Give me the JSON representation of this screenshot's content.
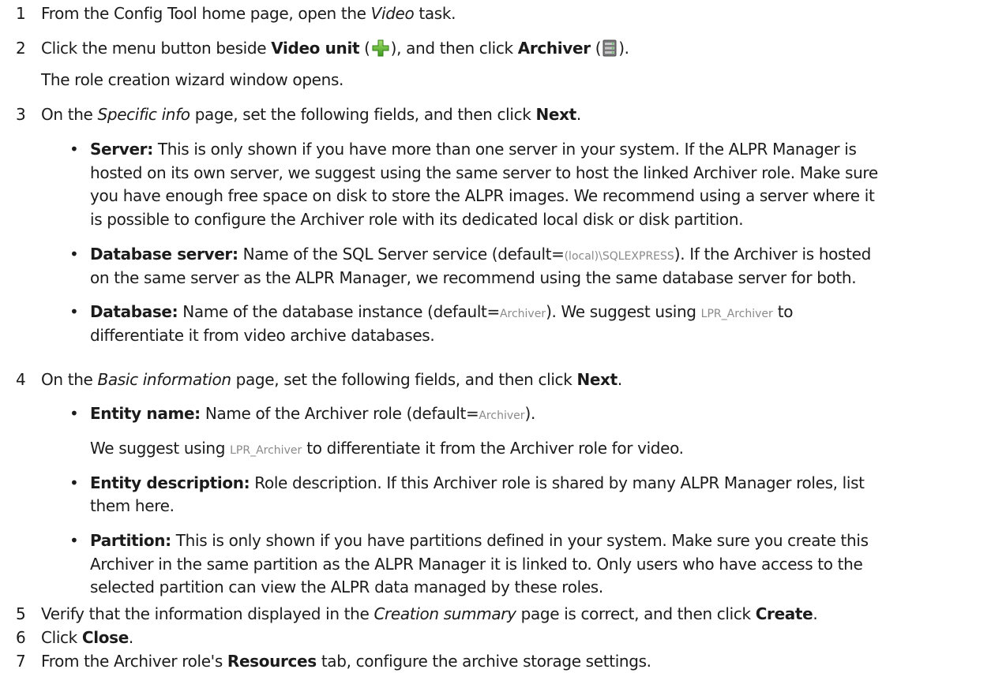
{
  "steps": [
    {
      "num": "1",
      "before": "From the Config Tool home page, open the ",
      "em": "Video",
      "after": " task."
    },
    {
      "num": "2",
      "a": "Click the menu button beside ",
      "b1": "Video unit",
      "c": " (",
      "d": "), and then click ",
      "b2": "Archiver",
      "e": " (",
      "f": ")."
    },
    {
      "num": "3",
      "before": "On the ",
      "em": "Specific info",
      "after": " page, set the following fields, and then click ",
      "bold": "Next",
      "end": "."
    },
    {
      "num": "4",
      "before": "On the ",
      "em": "Basic information",
      "after": " page, set the following fields, and then click ",
      "bold": "Next",
      "end": "."
    },
    {
      "num": "5",
      "before": "Verify that the information displayed in the ",
      "em": "Creation summary",
      "after": " page is correct, and then click ",
      "bold": "Create",
      "end": "."
    },
    {
      "num": "6",
      "before": "Click ",
      "bold": "Close",
      "end": "."
    },
    {
      "num": "7",
      "before": "From the Archiver role's ",
      "bold": "Resources",
      "after": " tab, configure the archive storage settings."
    }
  ],
  "step2_result": "The role creation wizard window opens.",
  "step3_bullets": {
    "server": {
      "label": "Server:",
      "lines": [
        " This is only shown if you have more than one server in your system. If the ALPR Manager is",
        "hosted on its own server, we suggest using the same server to host the linked Archiver role. Make sure",
        "you have enough free space on disk to store the ALPR images. We recommend using a server where it",
        "is possible to configure the Archiver role with its dedicated local disk or disk partition."
      ]
    },
    "db_server": {
      "label": "Database server:",
      "a": " Name of the SQL Server service (default=",
      "code": "(local)\\SQLEXPRESS",
      "b": "). If the Archiver is hosted",
      "line2": "on the same server as the ALPR Manager, we recommend using the same database server for both."
    },
    "database": {
      "label": "Database:",
      "a": " Name of the database instance (default=",
      "code1": "Archiver",
      "b": "). We suggest using ",
      "code2": "LPR_Archiver",
      "c": " to",
      "line2": "differentiate it from video archive databases."
    }
  },
  "step4_bullets": {
    "entity_name": {
      "label": "Entity name:",
      "a": " Name of the Archiver role (default=",
      "code": "Archiver",
      "b": ").",
      "note_a": "We suggest using ",
      "note_code": "LPR_Archiver",
      "note_b": " to differentiate it from the Archiver role for video."
    },
    "entity_desc": {
      "label": "Entity description:",
      "line1": " Role description. If this Archiver role is shared by many ALPR Manager roles, list",
      "line2": "them here."
    },
    "partition": {
      "label": "Partition:",
      "line1": " This is only shown if you have partitions defined in your system. Make sure you create this",
      "line2": "Archiver in the same partition as the ALPR Manager it is linked to. Only users who have access to the",
      "line3": "selected partition can view the ALPR data managed by these roles."
    }
  },
  "bullet_glyph": "•",
  "icons": {
    "video_unit": "plus-icon",
    "archiver": "archiver-icon"
  }
}
